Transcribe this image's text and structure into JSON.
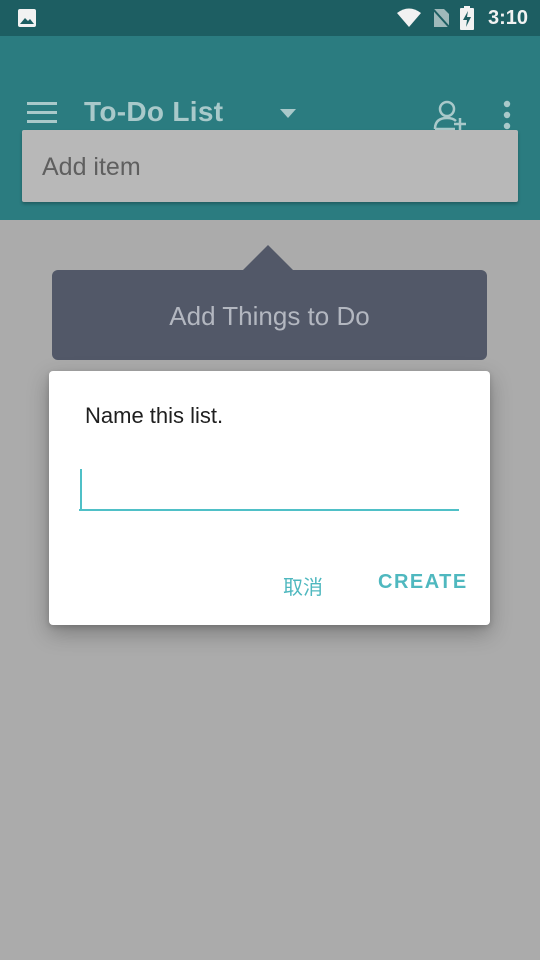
{
  "status_bar": {
    "time": "3:10",
    "left_icon": "image-icon",
    "icons": [
      "wifi-icon",
      "no-sim-icon",
      "battery-charging-icon"
    ]
  },
  "app_bar": {
    "title": "To-Do List",
    "menu_icon": "menu-icon",
    "dropdown_icon": "chevron-down-icon",
    "actions": [
      "add-person-icon",
      "more-vert-icon"
    ]
  },
  "add_item": {
    "placeholder": "Add item"
  },
  "tooltip": {
    "text": "Add Things to Do"
  },
  "dialog": {
    "title": "Name this list.",
    "input_value": "",
    "cancel_label": "取消",
    "create_label": "CREATE"
  },
  "colors": {
    "status_bar": "#1d5e62",
    "app_bar": "#2b7c80",
    "scrim_background": "#ababab",
    "accent": "#4fb8bf",
    "tooltip": "#525868"
  }
}
